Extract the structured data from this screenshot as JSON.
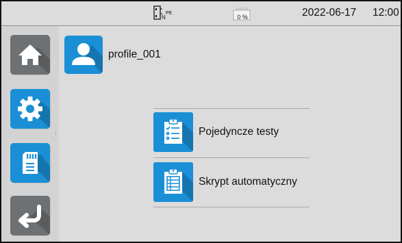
{
  "status_bar": {
    "connector_label": "N PE",
    "battery_percent_text": "0 %",
    "battery_level": 0,
    "date": "2022-06-17",
    "time": "12:00"
  },
  "sidebar": {
    "items": [
      {
        "icon": "home-icon",
        "color": "#6e7173"
      },
      {
        "icon": "gear-icon",
        "color": "#1a8fd6"
      },
      {
        "icon": "sd-card-icon",
        "color": "#1a8fd6"
      },
      {
        "icon": "back-arrow-icon",
        "color": "#6e7173"
      }
    ]
  },
  "profile": {
    "icon": "user-icon",
    "name": "profile_001"
  },
  "menu": {
    "items": [
      {
        "icon": "clipboard-checklist-icon",
        "label": "Pojedyncze testy"
      },
      {
        "icon": "clipboard-script-icon",
        "label": "Skrypt automatyczny"
      }
    ]
  },
  "colors": {
    "accent": "#1a8fd6",
    "inactive": "#6e7173",
    "background": "#dcdcdc"
  }
}
